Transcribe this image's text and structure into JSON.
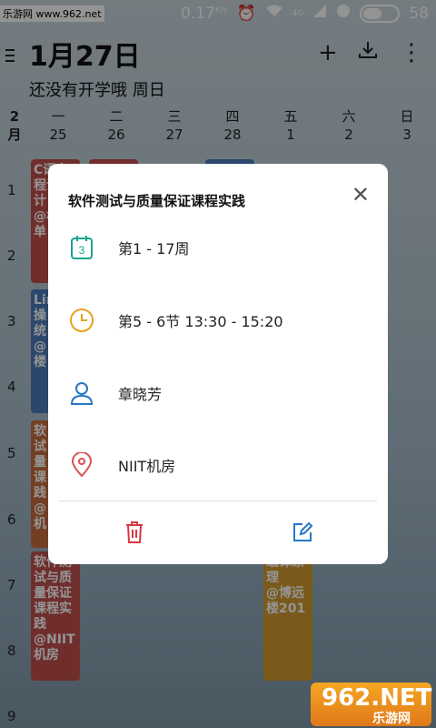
{
  "statusbar": {
    "watermark": "乐游网 www.962.net",
    "net_speed": "0.17",
    "net_unit": "K/s",
    "battery": "58",
    "signal_label": "4G"
  },
  "header": {
    "date": "1月27日",
    "subtitle": "还没有开学哦  周日",
    "add_icon": "+",
    "more_icon": "⋮"
  },
  "week": {
    "month_num": "2",
    "month_unit": "月",
    "days": [
      {
        "name": "一",
        "date": "25"
      },
      {
        "name": "二",
        "date": "26"
      },
      {
        "name": "三",
        "date": "27"
      },
      {
        "name": "四",
        "date": "28"
      },
      {
        "name": "五",
        "date": "1"
      },
      {
        "name": "六",
        "date": "2"
      },
      {
        "name": "日",
        "date": "3"
      }
    ]
  },
  "sections": [
    "1",
    "2",
    "3",
    "4",
    "5",
    "6",
    "7",
    "8",
    "9"
  ],
  "courses": {
    "c1": "C语言\n程设\n计\n@机\n单",
    "c2": "Lin\n操\n统\n@\n楼",
    "c3": "软\n试\n量\n课\n践\n@\n机",
    "c4": "软件测\n试与质\n量保证\n课程实\n践\n@NIIT\n机房",
    "c5": "编译原\n理\n@博远\n楼201",
    "colors": {
      "red": "#c0504d",
      "blue": "#4a7ab8",
      "orange": "#c76d3c",
      "gold": "#d39b2f"
    }
  },
  "dialog": {
    "title": "软件测试与质量保证课程实践",
    "weeks": "第1 - 17周",
    "time": "第5 - 6节    13:30 - 15:20",
    "teacher": "章晓芳",
    "location": "NIIT机房",
    "calendar_icon_num": "3",
    "close_icon": "✕"
  },
  "logo": {
    "top": "962.NET",
    "bottom": "乐游网"
  }
}
